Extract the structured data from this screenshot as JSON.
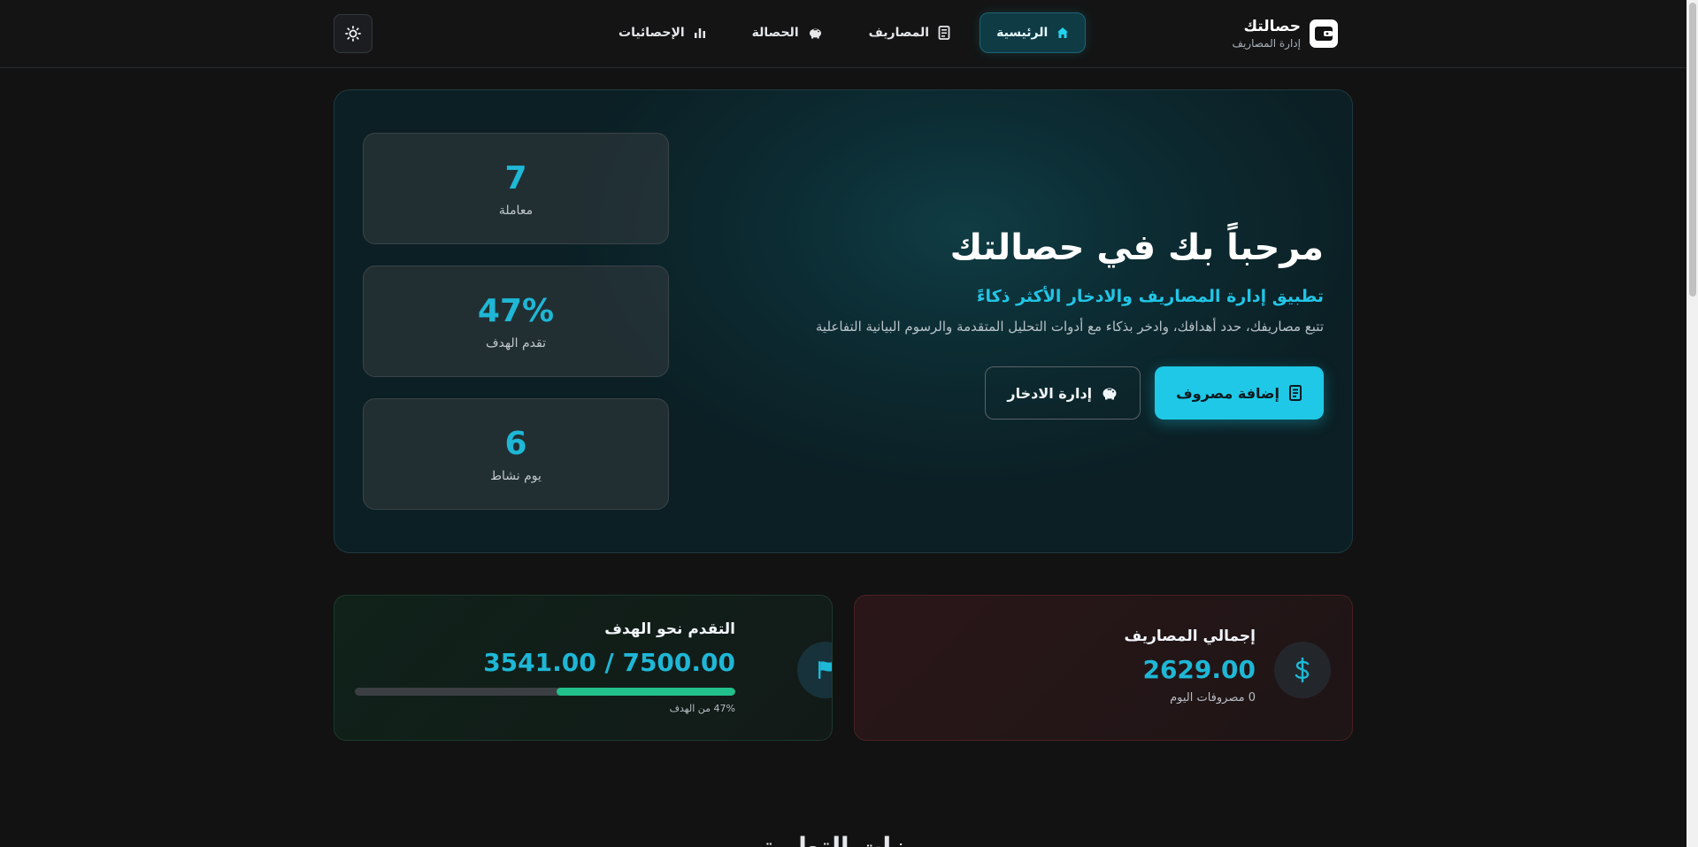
{
  "brand": {
    "title": "حصالتك",
    "subtitle": "إدارة المصاريف"
  },
  "nav": {
    "items": [
      {
        "label": "الرئيسية",
        "icon": "home-icon",
        "active": true
      },
      {
        "label": "المصاريف",
        "icon": "receipt-icon",
        "active": false
      },
      {
        "label": "الحصالة",
        "icon": "piggy-bank-icon",
        "active": false
      },
      {
        "label": "الإحصائيات",
        "icon": "bar-chart-icon",
        "active": false
      }
    ]
  },
  "theme_toggle": {
    "icon": "sun-icon"
  },
  "hero": {
    "title": "مرحباً بك في حصالتك",
    "subtitle": "تطبيق إدارة المصاريف والادخار الأكثر ذكاءً",
    "description": "تتبع مصاريفك، حدد أهدافك، وادخر بذكاء مع أدوات التحليل المتقدمة والرسوم البيانية التفاعلية",
    "add_expense_label": "إضافة مصروف",
    "manage_savings_label": "إدارة الادخار"
  },
  "stats": [
    {
      "value": "7",
      "label": "معاملة"
    },
    {
      "value": "47%",
      "label": "تقدم الهدف"
    },
    {
      "value": "6",
      "label": "يوم نشاط"
    }
  ],
  "expenses_card": {
    "title": "إجمالي المصاريف",
    "value": "2629.00",
    "note": "0 مصروفات اليوم",
    "icon": "dollar-icon"
  },
  "goal_card": {
    "title": "التقدم نحو الهدف",
    "value": "7500.00 / 3541.00",
    "progress_percent": 47,
    "progress_note": "47% من الهدف",
    "icon": "flag-icon"
  },
  "features_section": {
    "title": "ميزات التطبيق"
  },
  "colors": {
    "accent": "#1fc8e6",
    "progress": "#22c08a",
    "background": "#121212"
  }
}
